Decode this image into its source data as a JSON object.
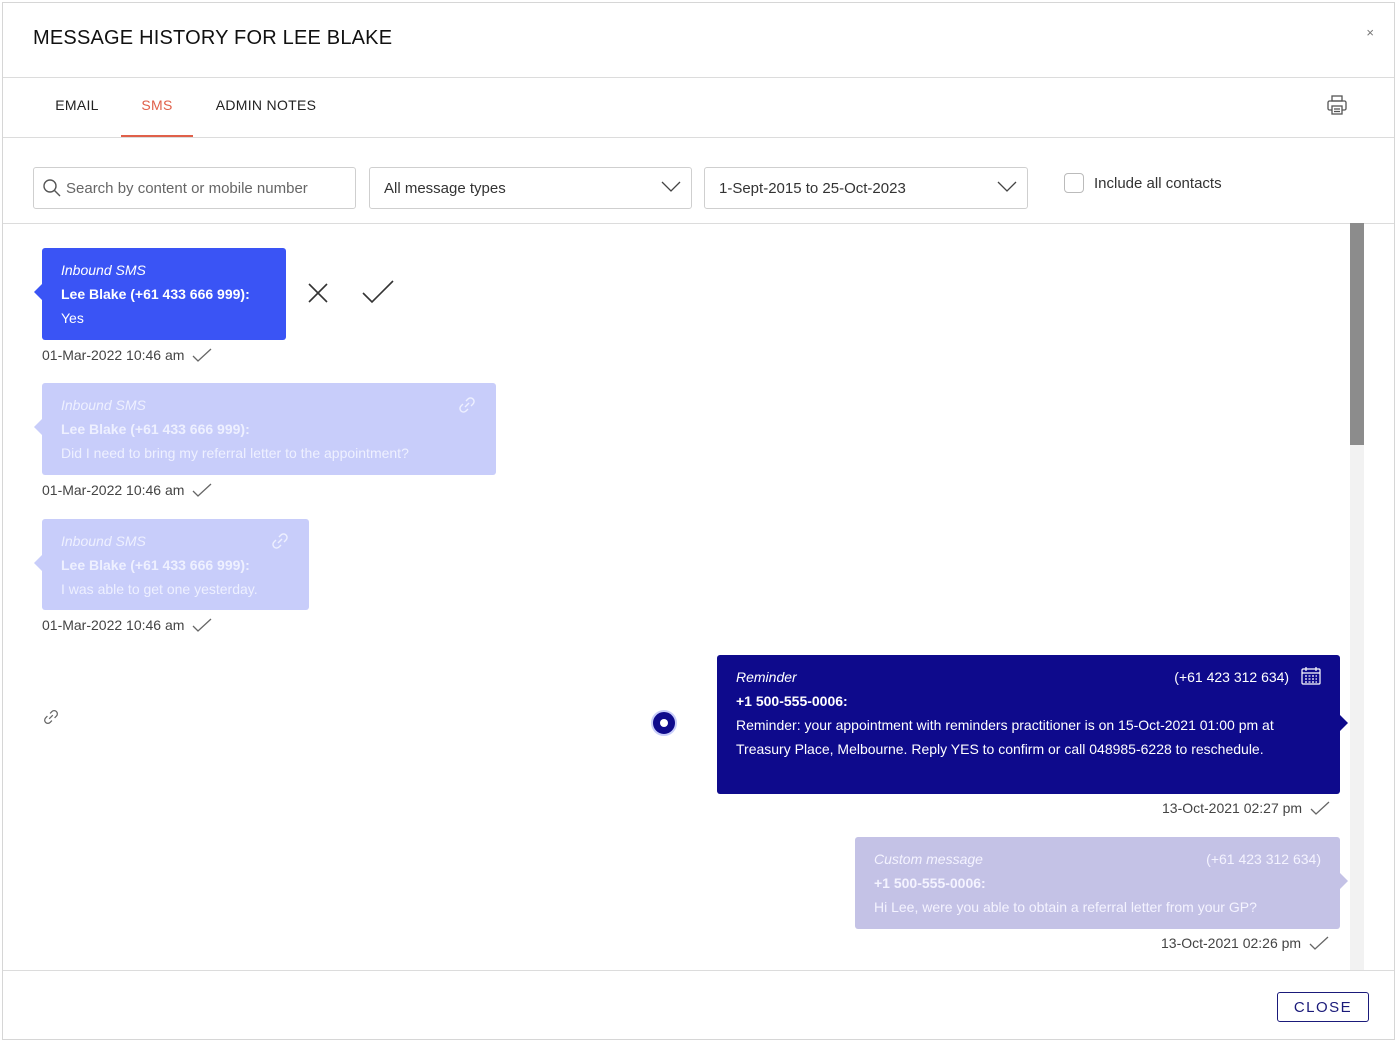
{
  "modal": {
    "title": "MESSAGE HISTORY FOR LEE BLAKE",
    "close_icon": "×"
  },
  "tabs": [
    {
      "label": "EMAIL",
      "active": false
    },
    {
      "label": "SMS",
      "active": true
    },
    {
      "label": "ADMIN NOTES",
      "active": false
    }
  ],
  "filters": {
    "search_placeholder": "Search by content or mobile number",
    "message_type": "All message types",
    "date_range": "1-Sept-2015 to 25-Oct-2023",
    "include_all_contacts_label": "Include all contacts",
    "include_all_contacts_checked": false
  },
  "messages": [
    {
      "type": "Inbound SMS",
      "from": "Lee Blake (+61 433 666 999):",
      "body": "Yes",
      "timestamp": "01-Mar-2022 10:46 am"
    },
    {
      "type": "Inbound SMS",
      "from": "Lee Blake (+61 433 666 999):",
      "body": "Did I need to bring my referral letter to the appointment?",
      "timestamp": "01-Mar-2022 10:46 am"
    },
    {
      "type": "Inbound SMS",
      "from": "Lee Blake (+61 433 666 999):",
      "body": "I was able to get one yesterday.",
      "timestamp": "01-Mar-2022 10:46 am"
    },
    {
      "type": "Reminder",
      "to": "(+61 423 312 634)",
      "from": "+1 500-555-0006:",
      "body": "Reminder: your appointment with reminders practitioner is on 15-Oct-2021 01:00 pm at Treasury Place, Melbourne. Reply YES to confirm or call 048985-6228 to reschedule.",
      "timestamp": "13-Oct-2021 02:27 pm"
    },
    {
      "type": "Custom message",
      "to": "(+61 423 312 634)",
      "from": "+1 500-555-0006:",
      "body": "Hi Lee, were you able to obtain a referral letter from your GP?",
      "timestamp": "13-Oct-2021 02:26 pm"
    }
  ],
  "footer": {
    "close_label": "CLOSE"
  },
  "colors": {
    "accent_tab": "#e0604a",
    "inbound_active": "#3a54f5",
    "inbound_muted": "#c8cdfa",
    "outbound_active": "#0e0a8c",
    "outbound_muted": "#c4c2e6"
  }
}
